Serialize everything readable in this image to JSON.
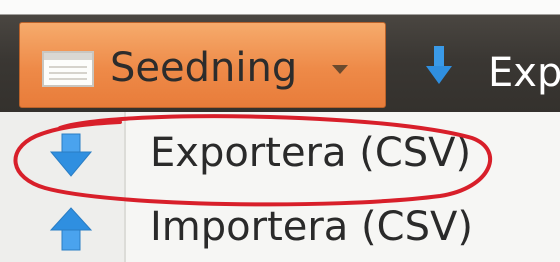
{
  "toolbar": {
    "seedning_label": "Seedning",
    "seedning_icon": "table-icon",
    "seedning_caret": "chevron-down-icon",
    "export_label": "Exp",
    "export_icon": "arrow-down-icon"
  },
  "menu": {
    "items": [
      {
        "label": "Exportera (CSV)",
        "icon": "arrow-down-icon"
      },
      {
        "label": "Importera (CSV)",
        "icon": "arrow-up-icon"
      }
    ]
  },
  "colors": {
    "accent": "#ee8a48",
    "toolbar_bg": "#3a3733",
    "arrow_blue": "#2f8fe0",
    "annotation_red": "#d81f2a"
  }
}
